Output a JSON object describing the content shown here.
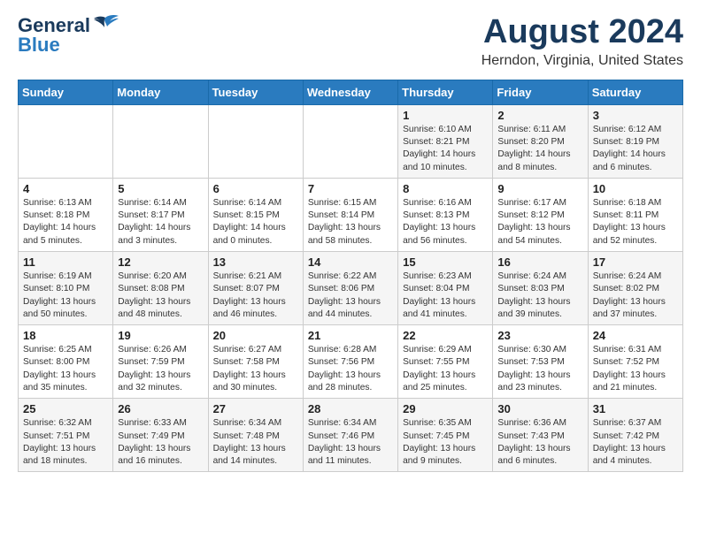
{
  "logo": {
    "general": "General",
    "blue": "Blue"
  },
  "header": {
    "title": "August 2024",
    "subtitle": "Herndon, Virginia, United States"
  },
  "days_of_week": [
    "Sunday",
    "Monday",
    "Tuesday",
    "Wednesday",
    "Thursday",
    "Friday",
    "Saturday"
  ],
  "weeks": [
    [
      {
        "day": "",
        "info": ""
      },
      {
        "day": "",
        "info": ""
      },
      {
        "day": "",
        "info": ""
      },
      {
        "day": "",
        "info": ""
      },
      {
        "day": "1",
        "info": "Sunrise: 6:10 AM\nSunset: 8:21 PM\nDaylight: 14 hours\nand 10 minutes."
      },
      {
        "day": "2",
        "info": "Sunrise: 6:11 AM\nSunset: 8:20 PM\nDaylight: 14 hours\nand 8 minutes."
      },
      {
        "day": "3",
        "info": "Sunrise: 6:12 AM\nSunset: 8:19 PM\nDaylight: 14 hours\nand 6 minutes."
      }
    ],
    [
      {
        "day": "4",
        "info": "Sunrise: 6:13 AM\nSunset: 8:18 PM\nDaylight: 14 hours\nand 5 minutes."
      },
      {
        "day": "5",
        "info": "Sunrise: 6:14 AM\nSunset: 8:17 PM\nDaylight: 14 hours\nand 3 minutes."
      },
      {
        "day": "6",
        "info": "Sunrise: 6:14 AM\nSunset: 8:15 PM\nDaylight: 14 hours\nand 0 minutes."
      },
      {
        "day": "7",
        "info": "Sunrise: 6:15 AM\nSunset: 8:14 PM\nDaylight: 13 hours\nand 58 minutes."
      },
      {
        "day": "8",
        "info": "Sunrise: 6:16 AM\nSunset: 8:13 PM\nDaylight: 13 hours\nand 56 minutes."
      },
      {
        "day": "9",
        "info": "Sunrise: 6:17 AM\nSunset: 8:12 PM\nDaylight: 13 hours\nand 54 minutes."
      },
      {
        "day": "10",
        "info": "Sunrise: 6:18 AM\nSunset: 8:11 PM\nDaylight: 13 hours\nand 52 minutes."
      }
    ],
    [
      {
        "day": "11",
        "info": "Sunrise: 6:19 AM\nSunset: 8:10 PM\nDaylight: 13 hours\nand 50 minutes."
      },
      {
        "day": "12",
        "info": "Sunrise: 6:20 AM\nSunset: 8:08 PM\nDaylight: 13 hours\nand 48 minutes."
      },
      {
        "day": "13",
        "info": "Sunrise: 6:21 AM\nSunset: 8:07 PM\nDaylight: 13 hours\nand 46 minutes."
      },
      {
        "day": "14",
        "info": "Sunrise: 6:22 AM\nSunset: 8:06 PM\nDaylight: 13 hours\nand 44 minutes."
      },
      {
        "day": "15",
        "info": "Sunrise: 6:23 AM\nSunset: 8:04 PM\nDaylight: 13 hours\nand 41 minutes."
      },
      {
        "day": "16",
        "info": "Sunrise: 6:24 AM\nSunset: 8:03 PM\nDaylight: 13 hours\nand 39 minutes."
      },
      {
        "day": "17",
        "info": "Sunrise: 6:24 AM\nSunset: 8:02 PM\nDaylight: 13 hours\nand 37 minutes."
      }
    ],
    [
      {
        "day": "18",
        "info": "Sunrise: 6:25 AM\nSunset: 8:00 PM\nDaylight: 13 hours\nand 35 minutes."
      },
      {
        "day": "19",
        "info": "Sunrise: 6:26 AM\nSunset: 7:59 PM\nDaylight: 13 hours\nand 32 minutes."
      },
      {
        "day": "20",
        "info": "Sunrise: 6:27 AM\nSunset: 7:58 PM\nDaylight: 13 hours\nand 30 minutes."
      },
      {
        "day": "21",
        "info": "Sunrise: 6:28 AM\nSunset: 7:56 PM\nDaylight: 13 hours\nand 28 minutes."
      },
      {
        "day": "22",
        "info": "Sunrise: 6:29 AM\nSunset: 7:55 PM\nDaylight: 13 hours\nand 25 minutes."
      },
      {
        "day": "23",
        "info": "Sunrise: 6:30 AM\nSunset: 7:53 PM\nDaylight: 13 hours\nand 23 minutes."
      },
      {
        "day": "24",
        "info": "Sunrise: 6:31 AM\nSunset: 7:52 PM\nDaylight: 13 hours\nand 21 minutes."
      }
    ],
    [
      {
        "day": "25",
        "info": "Sunrise: 6:32 AM\nSunset: 7:51 PM\nDaylight: 13 hours\nand 18 minutes."
      },
      {
        "day": "26",
        "info": "Sunrise: 6:33 AM\nSunset: 7:49 PM\nDaylight: 13 hours\nand 16 minutes."
      },
      {
        "day": "27",
        "info": "Sunrise: 6:34 AM\nSunset: 7:48 PM\nDaylight: 13 hours\nand 14 minutes."
      },
      {
        "day": "28",
        "info": "Sunrise: 6:34 AM\nSunset: 7:46 PM\nDaylight: 13 hours\nand 11 minutes."
      },
      {
        "day": "29",
        "info": "Sunrise: 6:35 AM\nSunset: 7:45 PM\nDaylight: 13 hours\nand 9 minutes."
      },
      {
        "day": "30",
        "info": "Sunrise: 6:36 AM\nSunset: 7:43 PM\nDaylight: 13 hours\nand 6 minutes."
      },
      {
        "day": "31",
        "info": "Sunrise: 6:37 AM\nSunset: 7:42 PM\nDaylight: 13 hours\nand 4 minutes."
      }
    ]
  ]
}
